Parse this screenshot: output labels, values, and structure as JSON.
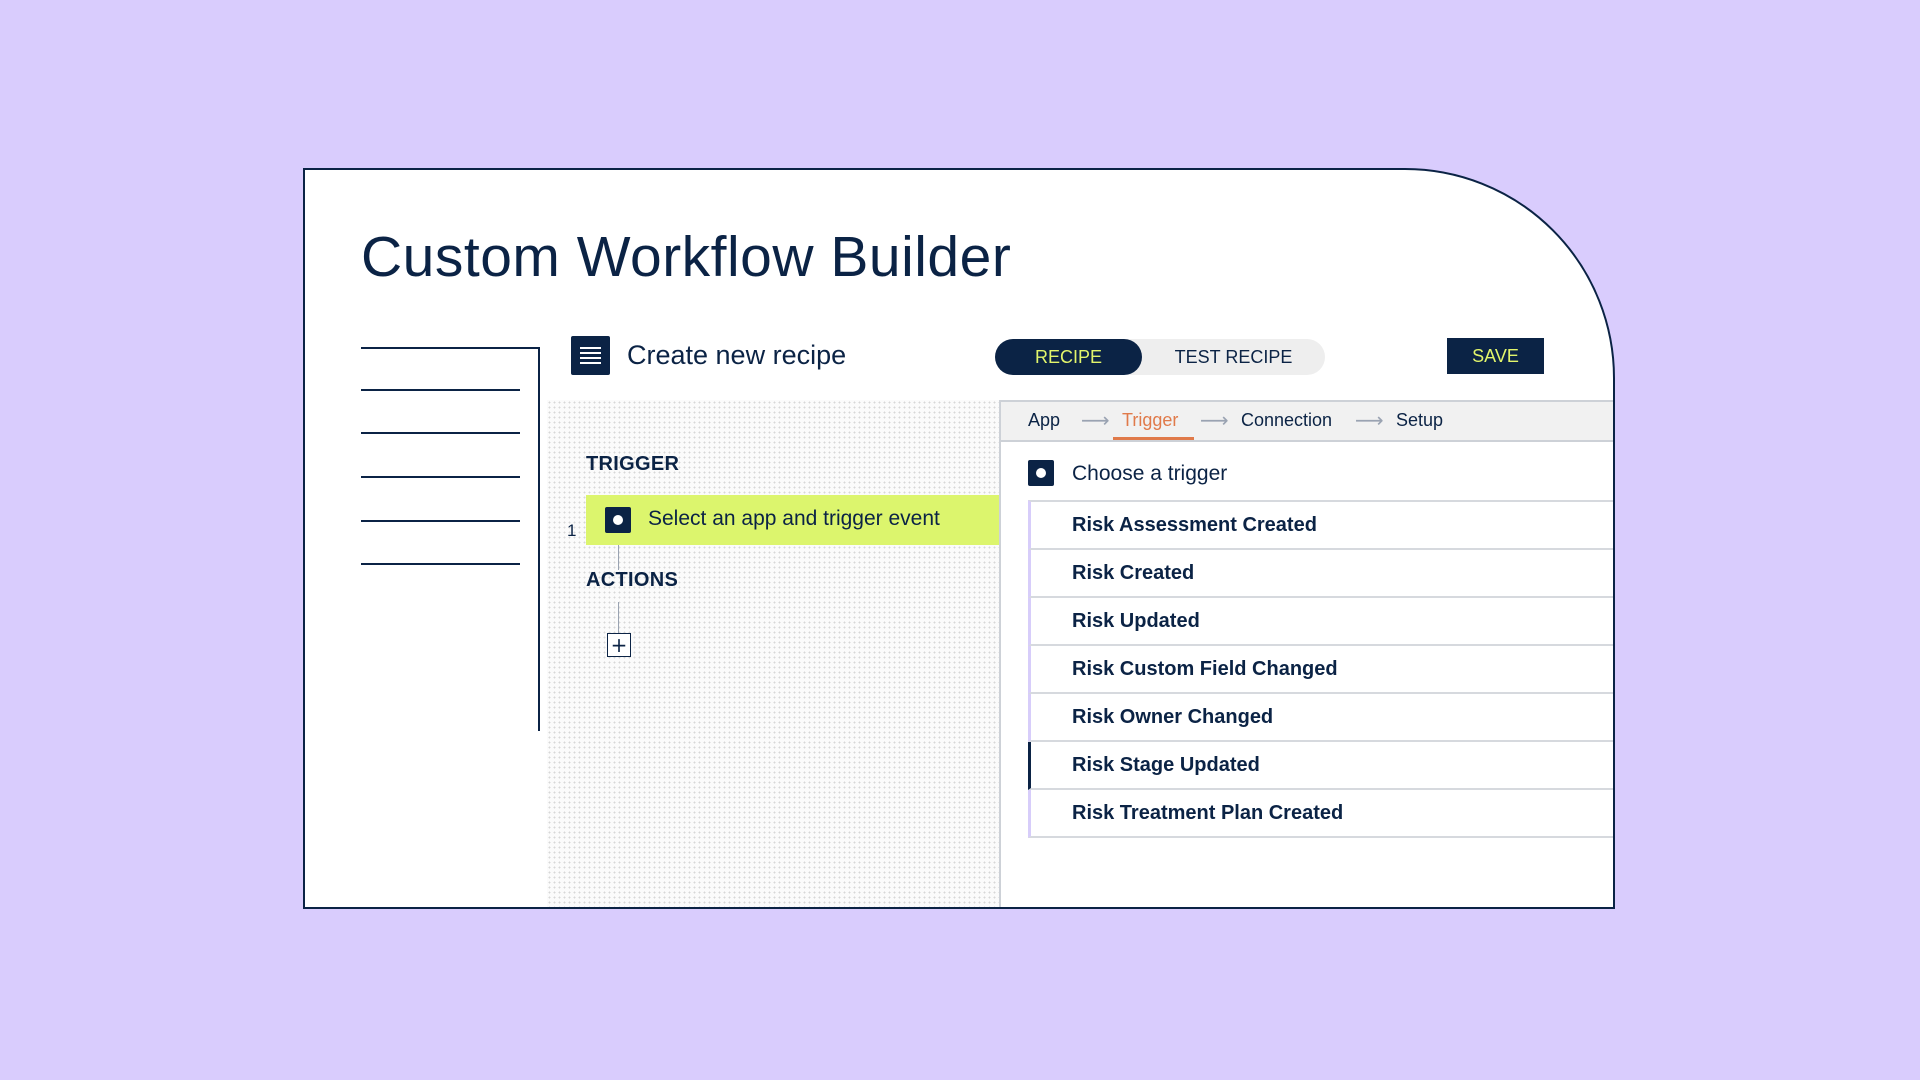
{
  "page": {
    "title": "Custom Workflow Builder"
  },
  "header": {
    "recipe_title": "Create new recipe",
    "doc_icon": "document-icon",
    "toggle": {
      "active_label": "RECIPE",
      "inactive_label": "TEST RECIPE"
    },
    "save_label": "SAVE"
  },
  "canvas": {
    "trigger_heading": "TRIGGER",
    "step_number": "1",
    "trigger_step_label": "Select an app and trigger event",
    "actions_heading": "ACTIONS",
    "add_icon": "plus-icon"
  },
  "panel": {
    "steps": [
      {
        "label": "App"
      },
      {
        "label": "Trigger"
      },
      {
        "label": "Connection"
      },
      {
        "label": "Setup"
      }
    ],
    "current_step": "Trigger",
    "arrow_icon": "arrow-right-icon",
    "choose_label": "Choose a trigger",
    "triggers": [
      {
        "label": "Risk Assessment Created"
      },
      {
        "label": "Risk Created"
      },
      {
        "label": "Risk Updated"
      },
      {
        "label": "Risk Custom Field Changed"
      },
      {
        "label": "Risk Owner Changed"
      },
      {
        "label": "Risk Stage Updated"
      },
      {
        "label": "Risk Treatment Plan Created"
      }
    ],
    "selected_trigger": "Risk Stage Updated"
  },
  "colors": {
    "background": "#d9ccfd",
    "navy": "#0b2345",
    "lime_accent": "#dcf56d",
    "save_text": "#e2f56b",
    "active_step": "#e07a4a"
  }
}
